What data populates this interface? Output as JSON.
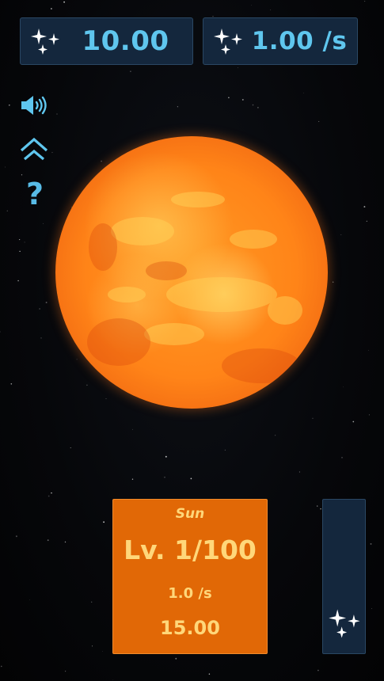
{
  "currency": {
    "total": "10.00",
    "rate": "1.00 /s"
  },
  "icons": {
    "currency": "sparkle-stars-icon",
    "sound": "speaker-icon",
    "prestige": "double-chevron-up-icon",
    "help": "question-mark-icon"
  },
  "help_glyph": "?",
  "upgrade": {
    "name": "Sun",
    "level": "Lv. 1/100",
    "rate": "1.0 /s",
    "cost": "15.00"
  },
  "colors": {
    "accent": "#5fc6ee",
    "panel": "#14273d",
    "card": "#e16806",
    "card_text": "#ffd77a"
  }
}
